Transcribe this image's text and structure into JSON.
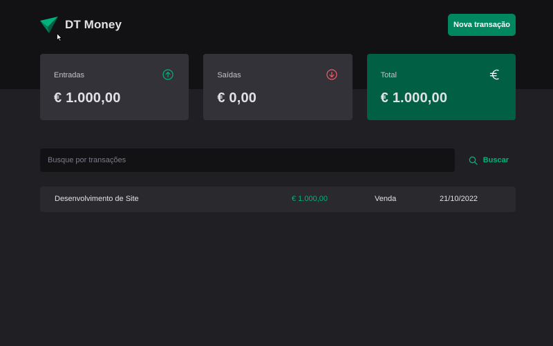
{
  "app": {
    "name": "DT Money"
  },
  "header": {
    "new_transaction_label": "Nova transação"
  },
  "summary": {
    "income": {
      "label": "Entradas",
      "value": "€ 1.000,00",
      "icon": "arrow-circle-up-icon"
    },
    "outcome": {
      "label": "Saídas",
      "value": "€ 0,00",
      "icon": "arrow-circle-down-icon"
    },
    "total": {
      "label": "Total",
      "value": "€ 1.000,00",
      "icon": "euro-icon"
    }
  },
  "search": {
    "placeholder": "Busque por transações",
    "button_label": "Buscar"
  },
  "transactions": [
    {
      "description": "Desenvolvimento de Site",
      "price": "€ 1.000,00",
      "category": "Venda",
      "date": "21/10/2022"
    }
  ],
  "colors": {
    "background": "#202024",
    "header": "#121214",
    "card": "#323238",
    "row": "#29292e",
    "brand_green": "#00875f",
    "total_card": "#015f43",
    "income_green": "#00b37e",
    "outcome_red": "#f75a68"
  }
}
